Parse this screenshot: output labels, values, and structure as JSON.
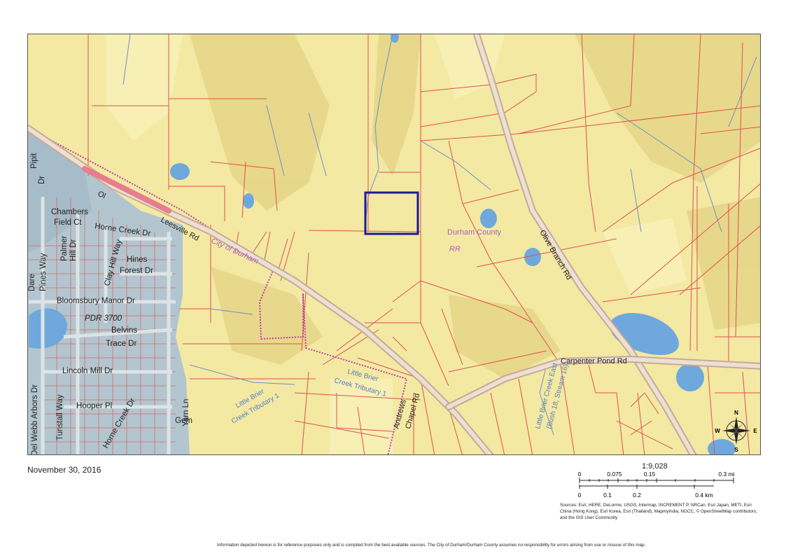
{
  "map": {
    "date": "November 30, 2016",
    "scale": {
      "ratio": "1:9,028",
      "mi_ticks": [
        "0",
        "0.075",
        "0.15",
        "0.3 mi"
      ],
      "km_ticks": [
        "0",
        "0.1",
        "0.2",
        "0.4 km"
      ]
    },
    "sources": "Sources: Esri, HERE, DeLorme, USGS, Intermap, INCREMENT P, NRCan, Esri Japan, METI, Esri China (Hong Kong), Esri Korea, Esri (Thailand), MapmyIndia, NGCC, © OpenStreetMap contributors, and the GIS User Community",
    "disclaimer": "Information depicted hereon is for reference purposes only and is compiled from the best available sources. The City of Durham/Durham County assumes no responsibility for errors arising from use or misuse of this map.",
    "compass": {
      "n": "N",
      "s": "S",
      "e": "E",
      "w": "W"
    },
    "labels": {
      "leesville": "Leesville Rd",
      "city_of_durham": "City of Durham",
      "durham_county": "Durham County",
      "rr": "RR",
      "olive_branch": "Olive Branch Rd",
      "carpenter_pond": "Carpenter Pond Rd",
      "andrews_chapel_1": "Andrews",
      "andrews_chapel_2": "Chapel Rd",
      "pipit_1": "Pipit",
      "pipit_2": "Dr",
      "chambers_1": "Chambers",
      "chambers_2": "Field Ct",
      "horne_creek_top": "Horne Creek Dr",
      "palmer_1": "Palmer",
      "palmer_2": "Hill Dr",
      "clay_hill": "Clay Hill Way",
      "hines_1": "Hines",
      "hines_2": "Forest Dr",
      "dare_1": "Dare",
      "dare_2": "Pines Way",
      "bloomsbury": "Bloomsbury Manor Dr",
      "pdr": "PDR 3700",
      "belvins_1": "Belvins",
      "belvins_2": "Trace Dr",
      "lincoln_mill": "Lincoln Mill Dr",
      "del_webb": "Del Webb Arbors Dr",
      "tunstall": "Tunstall Way",
      "hooper": "Hooper Pl",
      "horne_creek_bottom": "Horne Creek Dr",
      "gem": "Gem",
      "yarn": "Yarn Ln",
      "lbct_1_a": "Little Brier",
      "lbct_1_b": "Creek Tributary 1",
      "lbct_top_a": "Little Brier",
      "lbct_top_b": "Creek Tributary 1",
      "lbc_east_a": "Little Brier Creek East",
      "lbc_east_b": "(Bush 18, Stream 16)",
      "ol": "Ol"
    }
  }
}
